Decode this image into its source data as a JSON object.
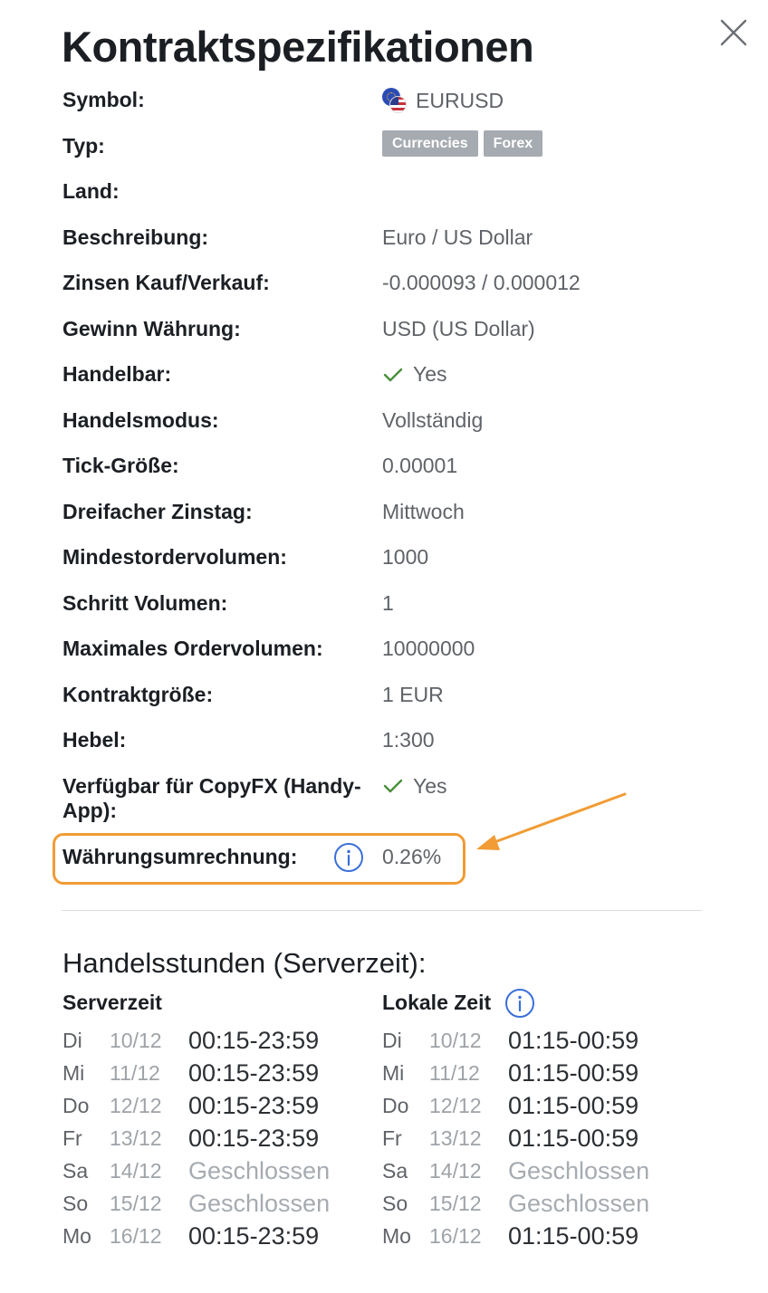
{
  "title": "Kontraktspezifikationen",
  "close_icon": "close-icon",
  "specs": {
    "symbol": {
      "label": "Symbol:",
      "value": "EURUSD",
      "icon": "eur-usd-flag-icon"
    },
    "type": {
      "label": "Typ:",
      "badges": [
        "Currencies",
        "Forex"
      ]
    },
    "country": {
      "label": "Land:",
      "value": ""
    },
    "description": {
      "label": "Beschreibung:",
      "value": "Euro / US Dollar"
    },
    "swap": {
      "label": "Zinsen Kauf/Verkauf:",
      "value": "-0.000093 / 0.000012"
    },
    "profit_currency": {
      "label": "Gewinn Währung:",
      "value": "USD (US Dollar)"
    },
    "tradable": {
      "label": "Handelbar:",
      "value": "Yes",
      "icon": "check-icon"
    },
    "trade_mode": {
      "label": "Handelsmodus:",
      "value": "Vollständig"
    },
    "tick_size": {
      "label": "Tick-Größe:",
      "value": "0.00001"
    },
    "triple_swap": {
      "label": "Dreifacher Zinstag:",
      "value": "Mittwoch"
    },
    "min_volume": {
      "label": "Mindestordervolumen:",
      "value": "1000"
    },
    "step_volume": {
      "label": "Schritt Volumen:",
      "value": "1"
    },
    "max_volume": {
      "label": "Maximales Ordervolumen:",
      "value": "10000000"
    },
    "contract_size": {
      "label": "Kontraktgröße:",
      "value": "1 EUR"
    },
    "leverage": {
      "label": "Hebel:",
      "value": "1:300"
    },
    "copyfx": {
      "label": "Verfügbar für CopyFX (Handy-App):",
      "value": "Yes",
      "icon": "check-icon"
    },
    "conversion": {
      "label": "Währungsumrechnung:",
      "value": "0.26%",
      "icon": "info-icon"
    }
  },
  "colors": {
    "highlight": "#f19c35",
    "check": "#4a8f3c",
    "info": "#3a6fd8",
    "badge": "#a6abb1"
  },
  "hours": {
    "title": "Handelsstunden (Serverzeit):",
    "server_heading": "Serverzeit",
    "local_heading": "Lokale Zeit",
    "server": [
      {
        "day": "Di",
        "date": "10/12",
        "time": "00:15-23:59",
        "closed": false
      },
      {
        "day": "Mi",
        "date": "11/12",
        "time": "00:15-23:59",
        "closed": false
      },
      {
        "day": "Do",
        "date": "12/12",
        "time": "00:15-23:59",
        "closed": false
      },
      {
        "day": "Fr",
        "date": "13/12",
        "time": "00:15-23:59",
        "closed": false
      },
      {
        "day": "Sa",
        "date": "14/12",
        "time": "Geschlossen",
        "closed": true
      },
      {
        "day": "So",
        "date": "15/12",
        "time": "Geschlossen",
        "closed": true
      },
      {
        "day": "Mo",
        "date": "16/12",
        "time": "00:15-23:59",
        "closed": false
      }
    ],
    "local": [
      {
        "day": "Di",
        "date": "10/12",
        "time": "01:15-00:59",
        "closed": false
      },
      {
        "day": "Mi",
        "date": "11/12",
        "time": "01:15-00:59",
        "closed": false
      },
      {
        "day": "Do",
        "date": "12/12",
        "time": "01:15-00:59",
        "closed": false
      },
      {
        "day": "Fr",
        "date": "13/12",
        "time": "01:15-00:59",
        "closed": false
      },
      {
        "day": "Sa",
        "date": "14/12",
        "time": "Geschlossen",
        "closed": true
      },
      {
        "day": "So",
        "date": "15/12",
        "time": "Geschlossen",
        "closed": true
      },
      {
        "day": "Mo",
        "date": "16/12",
        "time": "01:15-00:59",
        "closed": false
      }
    ]
  }
}
